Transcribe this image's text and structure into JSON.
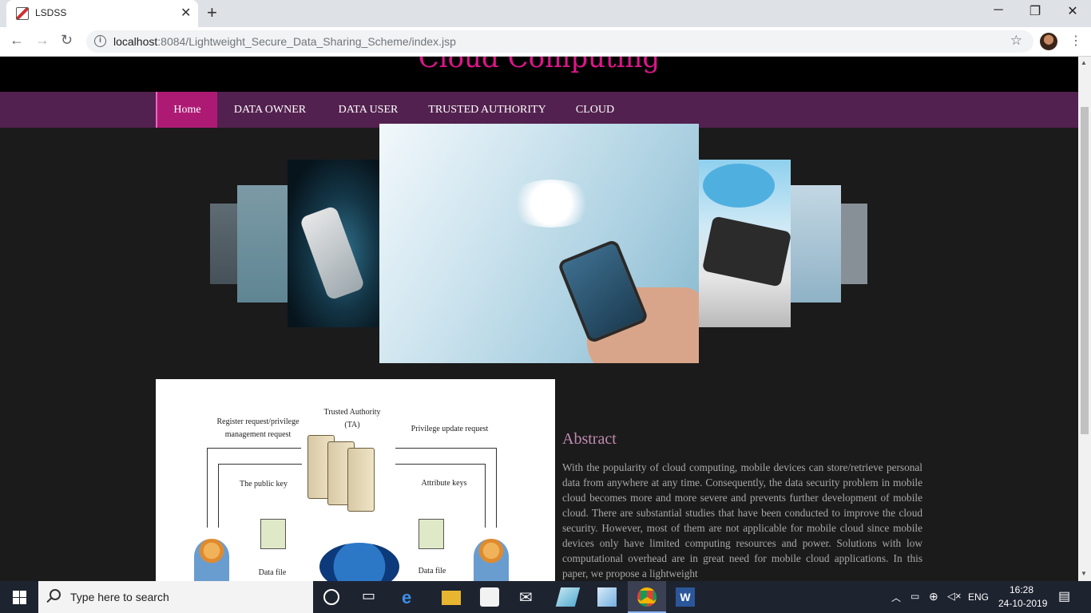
{
  "browser": {
    "tab_title": "LSDSS",
    "url_host": "localhost",
    "url_path": ":8084/Lightweight_Secure_Data_Sharing_Scheme/index.jsp"
  },
  "site": {
    "title": "Cloud Computing"
  },
  "nav": {
    "items": [
      {
        "label": "Home"
      },
      {
        "label": "DATA OWNER"
      },
      {
        "label": "DATA USER"
      },
      {
        "label": "TRUSTED AUTHORITY"
      },
      {
        "label": "CLOUD"
      }
    ],
    "active_color": "#ad1a74",
    "bar_color": "#53214f"
  },
  "diagram": {
    "trusted_authority": "Trusted Authority",
    "ta": "(TA)",
    "register_request": "Register request/privilege",
    "management_request": "management request",
    "privilege_update": "Privilege update request",
    "public_key": "The public key",
    "attribute_keys": "Attribute keys",
    "data_file_left": "Data file",
    "data_file_right": "Data file"
  },
  "abstract": {
    "heading": "Abstract",
    "text": "With the popularity of cloud computing, mobile devices can store/retrieve personal data from anywhere at any time. Consequently, the data security problem in mobile cloud becomes more and more severe and prevents further development of mobile cloud. There are substantial studies that have been conducted to improve the cloud security. However, most of them are not applicable for mobile cloud since mobile devices only have limited computing resources and power. Solutions with low computational overhead are in great need for mobile cloud applications. In this paper, we propose a lightweight"
  },
  "taskbar": {
    "search_placeholder": "Type here to search",
    "language": "ENG",
    "time": "16:28",
    "date": "24-10-2019"
  }
}
